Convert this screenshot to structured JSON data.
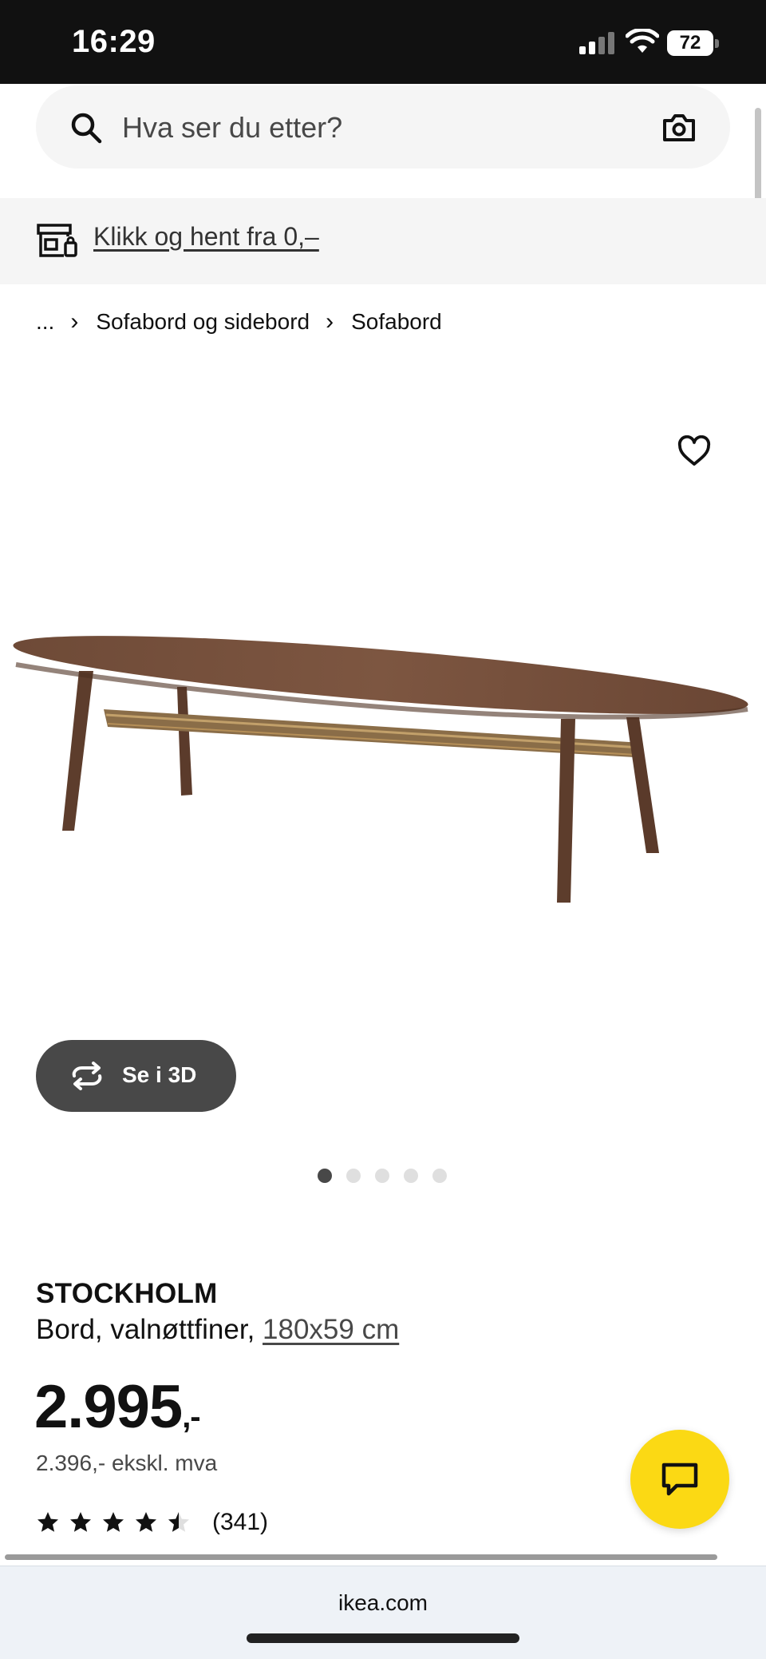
{
  "status_bar": {
    "time": "16:29",
    "battery": "72"
  },
  "search": {
    "placeholder": "Hva ser du etter?"
  },
  "banner": {
    "text": "Klikk og hent fra 0,–"
  },
  "breadcrumb": {
    "items": [
      "...",
      "Sofabord og sidebord",
      "Sofabord"
    ]
  },
  "product": {
    "view3d_label": "Se i 3D",
    "image_count": 5,
    "active_image": 1,
    "name": "STOCKHOLM",
    "description": "Bord, valnøttfiner, ",
    "size": "180x59 cm",
    "price": "2.995",
    "price_suffix": ",-",
    "price_ex_vat": "2.396,- ekskl. mva",
    "rating": 4.5,
    "rating_max": 5,
    "review_count": "(341)"
  },
  "browser": {
    "url": "ikea.com"
  },
  "colors": {
    "accent": "#fbd914",
    "dark": "#111111",
    "button": "#484848"
  }
}
